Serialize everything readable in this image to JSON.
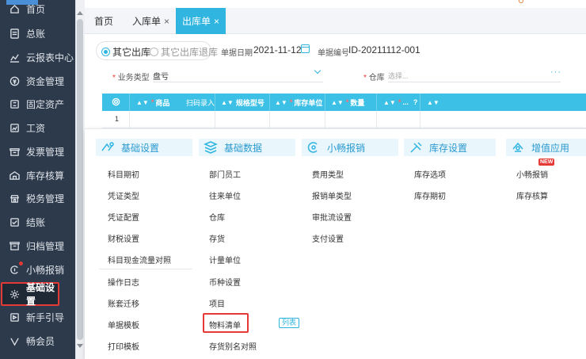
{
  "sidebar": {
    "items": [
      {
        "label": "首页",
        "icon": "home-icon"
      },
      {
        "label": "总账",
        "icon": "ledger-icon"
      },
      {
        "label": "云报表中心",
        "icon": "chart-icon"
      },
      {
        "label": "资金管理",
        "icon": "money-icon"
      },
      {
        "label": "固定资产",
        "icon": "asset-icon"
      },
      {
        "label": "工资",
        "icon": "salary-icon"
      },
      {
        "label": "发票管理",
        "icon": "invoice-icon"
      },
      {
        "label": "库存核算",
        "icon": "warehouse-icon"
      },
      {
        "label": "税务管理",
        "icon": "tax-icon"
      },
      {
        "label": "结账",
        "icon": "checkout-icon"
      },
      {
        "label": "归档管理",
        "icon": "archive-icon"
      },
      {
        "label": "小畅报销",
        "icon": "expense-icon"
      },
      {
        "label": "基础设置",
        "icon": "gear-icon"
      },
      {
        "label": "新手引导",
        "icon": "guide-icon"
      },
      {
        "label": "畅会员",
        "icon": "vip-icon"
      }
    ]
  },
  "tabs": [
    {
      "label": "首页"
    },
    {
      "label": "入库单",
      "close": "×"
    },
    {
      "label": "出库单",
      "close": "×"
    }
  ],
  "form": {
    "radio_other_out": "其它出库",
    "radio_other_out_return": "其它出库退库",
    "date_label": "单据日期",
    "date_value": "2021-11-12",
    "doc_no_label": "单据编号",
    "doc_no_value": "ID-20211112-001",
    "biz_type_label": "业务类型",
    "biz_type_value": "盘亏",
    "warehouse_label": "仓库",
    "warehouse_placeholder": "选择...",
    "more": "···"
  },
  "grid": {
    "headers": [
      {
        "label": "商品",
        "required": true
      },
      {
        "label": "扫码录入",
        "required": false
      },
      {
        "label": "规格型号",
        "required": false
      },
      {
        "label": "库存单位",
        "required": true
      },
      {
        "label": "数量",
        "required": true
      },
      {
        "label": "...",
        "required": true
      }
    ],
    "row_number": "1",
    "sort_glyph": "▲▼",
    "help_glyph": "?"
  },
  "menu": {
    "categories": [
      {
        "label": "基础设置",
        "icon": "settings-icon"
      },
      {
        "label": "基础数据",
        "icon": "data-icon"
      },
      {
        "label": "小畅报销",
        "icon": "expense-icon"
      },
      {
        "label": "库存设置",
        "icon": "tools-icon"
      },
      {
        "label": "增值应用",
        "icon": "app-icon"
      }
    ],
    "col1": [
      "科目期初",
      "凭证类型",
      "凭证配置",
      "财税设置",
      "科目现金流量对照",
      "操作日志",
      "账套迁移",
      "单据模板",
      "打印模板"
    ],
    "col2": [
      "部门员工",
      "往来单位",
      "仓库",
      "存货",
      "计量单位",
      "币种设置",
      "项目",
      "物料清单",
      "存货别名对照"
    ],
    "col3": [
      "费用类型",
      "报销单类型",
      "审批流设置",
      "支付设置"
    ],
    "col4": [
      "库存选项",
      "库存期初"
    ],
    "col5": [
      "小畅报销",
      "库存核算"
    ],
    "badge_list": "列表",
    "badge_new": "NEW"
  },
  "colors": {
    "sidebar_bg": "#2d3a4b",
    "accent": "#2fb5e0",
    "highlight": "#e53935"
  }
}
